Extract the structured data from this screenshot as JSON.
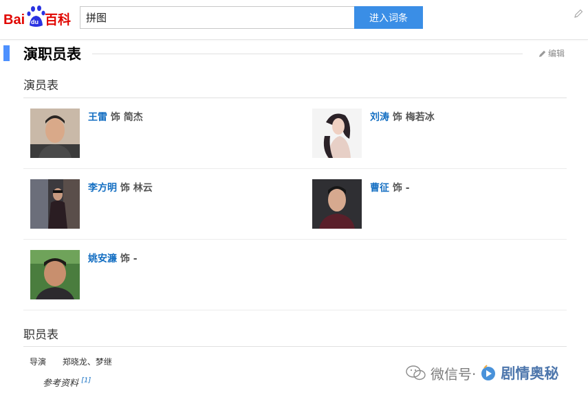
{
  "header": {
    "logo_text": "Bai du 百科",
    "search_value": "拼图",
    "search_button_label": "进入词条"
  },
  "section": {
    "title": "演职员表",
    "edit_label": "编辑"
  },
  "cast": {
    "subtitle": "演员表",
    "items": [
      {
        "actor": "王雷",
        "role_prefix": "饰",
        "role": "简杰"
      },
      {
        "actor": "刘涛",
        "role_prefix": "饰",
        "role": "梅若冰"
      },
      {
        "actor": "李方明",
        "role_prefix": "饰",
        "role": "林云"
      },
      {
        "actor": "曹征",
        "role_prefix": "饰",
        "role": "-"
      },
      {
        "actor": "姚安濂",
        "role_prefix": "饰",
        "role": "-"
      }
    ]
  },
  "staff": {
    "subtitle": "职员表",
    "rows": [
      {
        "label": "导演",
        "value": "郑晓龙、梦继"
      }
    ],
    "reference_label": "参考资料",
    "reference_mark": "[1]"
  },
  "watermark": {
    "text": "微信号·",
    "brand": "剧情奥秘"
  },
  "colors": {
    "accent": "#4d90fe",
    "link": "#136ec2",
    "button": "#3a8ee6"
  }
}
